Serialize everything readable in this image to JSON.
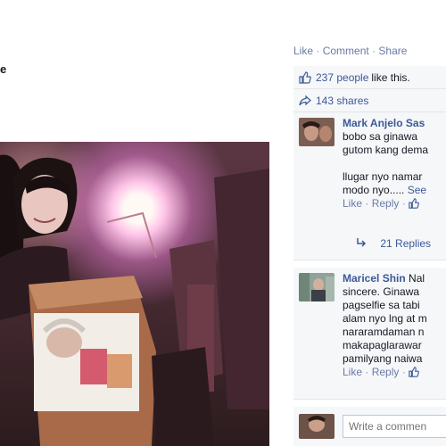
{
  "post": {
    "author_suffix": "e",
    "photo_alt": "Selfie photo"
  },
  "panel": {
    "actions": {
      "like": "Like",
      "comment": "Comment",
      "share": "Share",
      "separator": "·"
    },
    "likes": {
      "count_text": "237 people",
      "suffix_text": "like this."
    },
    "shares": {
      "text": "143 shares"
    },
    "comments": [
      {
        "name": "Mark Anjelo Sas",
        "lines": [
          "bobo sa ginawa",
          "gutom kang dema",
          "",
          "llugar nyo namar",
          "modo nyo....."
        ],
        "see_more": "See",
        "like_label": "Like",
        "reply_label": "Reply",
        "separator": "·"
      },
      {
        "name": "Maricel Shin",
        "name_tail": "Nal",
        "lines": [
          "sincere. Ginawa",
          "pagselfie sa tabi",
          "alam nyo lng at m",
          "nararamdaman n",
          "makapaglarawar",
          "pamilyang naiwa"
        ],
        "like_label": "Like",
        "reply_label": "Reply",
        "separator": "·"
      }
    ],
    "replies": {
      "text": "21 Replies"
    },
    "composer": {
      "placeholder": "Write a commen"
    }
  },
  "colors": {
    "link": "#3b5998",
    "muted_link": "#6b7aa6",
    "panel_bg": "#f6f7f9",
    "text": "#141823"
  },
  "icons": {
    "like": "thumbs-up-icon",
    "share": "share-arrow-icon",
    "reply": "reply-arrow-icon"
  }
}
